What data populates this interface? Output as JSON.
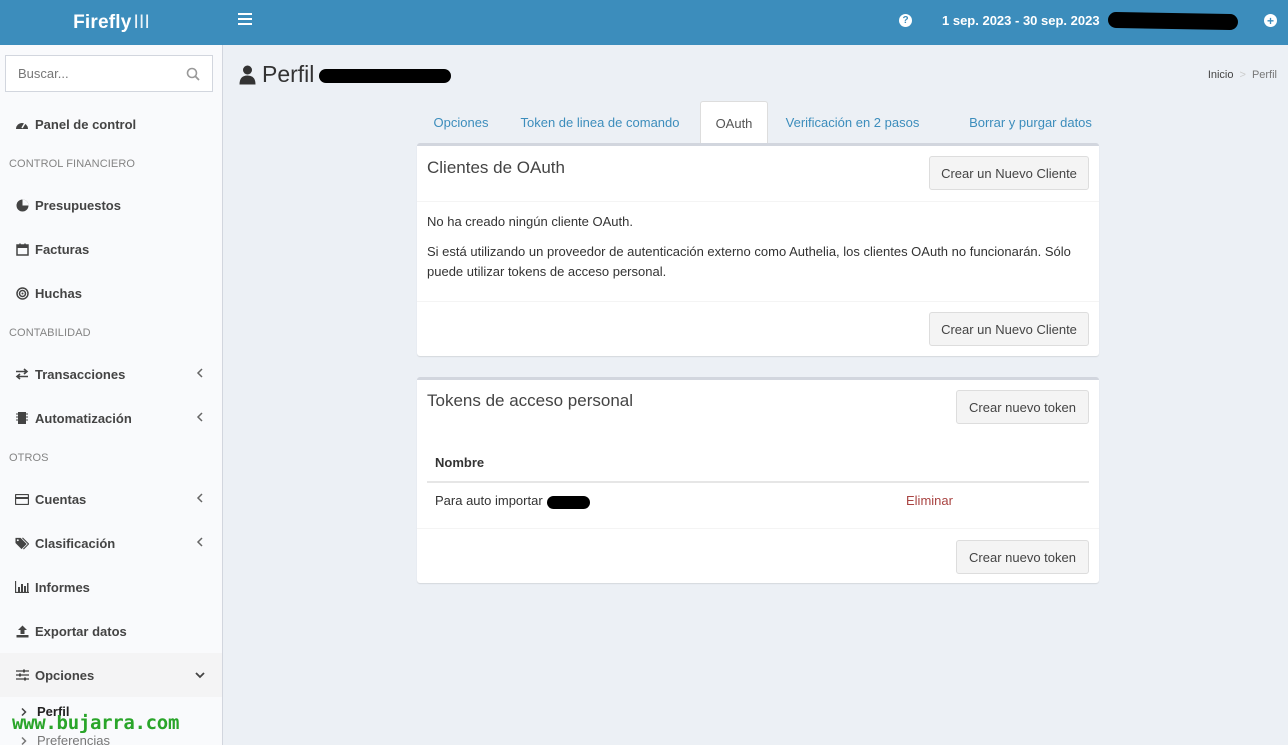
{
  "header": {
    "logo_bold": "Firefly",
    "logo_light": "III",
    "date_range": "1 sep. 2023 - 30 sep. 2023"
  },
  "sidebar": {
    "search_placeholder": "Buscar...",
    "items": {
      "dashboard": "Panel de control",
      "section_financial": "CONTROL FINANCIERO",
      "budgets": "Presupuestos",
      "bills": "Facturas",
      "piggy": "Huchas",
      "section_accounting": "CONTABILIDAD",
      "transactions": "Transacciones",
      "automation": "Automatización",
      "section_others": "OTROS",
      "accounts": "Cuentas",
      "classification": "Clasificación",
      "reports": "Informes",
      "export": "Exportar datos",
      "options": "Opciones",
      "profile": "Perfil",
      "preferences": "Preferencias"
    }
  },
  "page": {
    "title": "Perfil",
    "breadcrumb": [
      "Inicio",
      ">",
      "Perfil"
    ]
  },
  "tabs": [
    "Opciones",
    "Token de linea de comando",
    "OAuth",
    "Verificación en 2 pasos",
    "Borrar y purgar datos"
  ],
  "oauth": {
    "title": "Clientes de OAuth",
    "create_btn": "Crear un Nuevo Cliente",
    "no_clients": "No ha creado ningún cliente OAuth.",
    "external_line1": "Si está utilizando un proveedor de autenticación externo como Authelia, los clientes OAuth no funcionarán. Sólo",
    "external_line2": "puede utilizar tokens de acceso personal."
  },
  "tokens": {
    "title": "Tokens de acceso personal",
    "create_btn": "Crear nuevo token",
    "column_name": "Nombre",
    "rows": [
      {
        "name": "Para auto importar",
        "action": "Eliminar"
      }
    ]
  },
  "watermark": "www.bujarra.com",
  "colors": {
    "primary": "#3c8dbc",
    "danger": "#a94442"
  }
}
